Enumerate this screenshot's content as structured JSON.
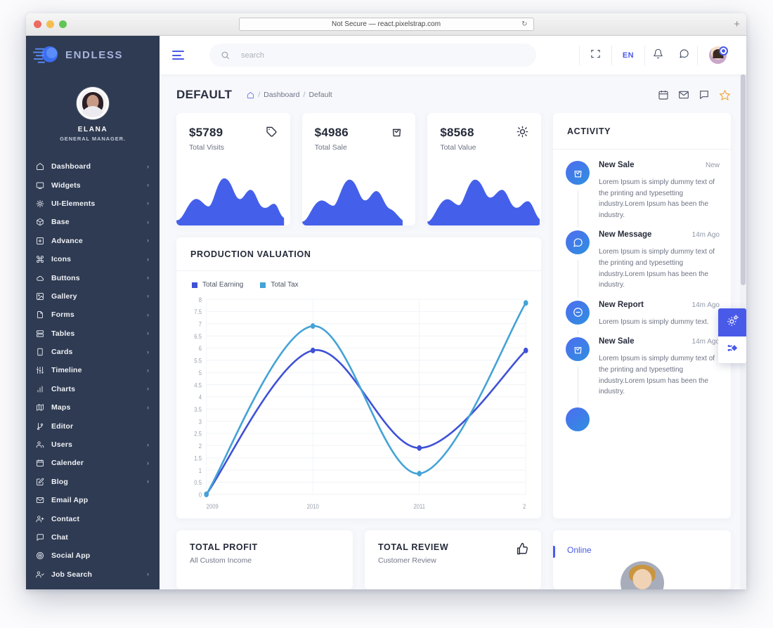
{
  "browser": {
    "url_text": "Not Secure — react.pixelstrap.com",
    "reload_icon": "reload-icon",
    "new_tab_label": "+"
  },
  "sidebar": {
    "brand": "ENDLESS",
    "profile": {
      "name": "ELANA",
      "role": "GENERAL MANAGER."
    },
    "items": [
      {
        "label": "Dashboard",
        "icon": "home-icon",
        "chevron": "›"
      },
      {
        "label": "Widgets",
        "icon": "monitor-icon",
        "chevron": "›"
      },
      {
        "label": "UI-Elements",
        "icon": "grid-dots-icon",
        "chevron": "›"
      },
      {
        "label": "Base",
        "icon": "box-icon",
        "chevron": "›"
      },
      {
        "label": "Advance",
        "icon": "plus-square-icon",
        "chevron": "›"
      },
      {
        "label": "Icons",
        "icon": "command-icon",
        "chevron": "›"
      },
      {
        "label": "Buttons",
        "icon": "cloud-icon",
        "chevron": "›"
      },
      {
        "label": "Gallery",
        "icon": "image-icon",
        "chevron": "›"
      },
      {
        "label": "Forms",
        "icon": "file-icon",
        "chevron": "›"
      },
      {
        "label": "Tables",
        "icon": "server-icon",
        "chevron": "›"
      },
      {
        "label": "Cards",
        "icon": "tablet-icon",
        "chevron": "›"
      },
      {
        "label": "Timeline",
        "icon": "sliders-icon",
        "chevron": "›"
      },
      {
        "label": "Charts",
        "icon": "bar-chart-icon",
        "chevron": "›"
      },
      {
        "label": "Maps",
        "icon": "map-icon",
        "chevron": "›"
      },
      {
        "label": "Editor",
        "icon": "git-branch-icon",
        "chevron": ""
      },
      {
        "label": "Users",
        "icon": "users-icon",
        "chevron": "›"
      },
      {
        "label": "Calender",
        "icon": "calendar-icon",
        "chevron": "›"
      },
      {
        "label": "Blog",
        "icon": "edit-square-icon",
        "chevron": "›"
      },
      {
        "label": "Email App",
        "icon": "mail-icon",
        "chevron": ""
      },
      {
        "label": "Contact",
        "icon": "user-plus-icon",
        "chevron": ""
      },
      {
        "label": "Chat",
        "icon": "message-square-icon",
        "chevron": ""
      },
      {
        "label": "Social App",
        "icon": "target-icon",
        "chevron": ""
      },
      {
        "label": "Job Search",
        "icon": "user-check-icon",
        "chevron": "›"
      }
    ]
  },
  "topbar": {
    "menu_icon": "hamburger-icon",
    "search": {
      "placeholder": "search",
      "value": "",
      "icon": "search-icon"
    },
    "fullscreen_icon": "fullscreen-icon",
    "language": "EN",
    "bell_icon": "bell-icon",
    "message_icon": "message-icon",
    "avatar": "user-avatar"
  },
  "page_head": {
    "title": "DEFAULT",
    "breadcrumb": {
      "home_icon": "home-icon",
      "items": [
        "Dashboard",
        "Default"
      ],
      "separator": "/"
    },
    "icons": [
      "calendar-icon",
      "mail-icon",
      "chat-icon",
      "star-icon"
    ]
  },
  "stats": [
    {
      "value": "$5789",
      "label": "Total Visits",
      "icon": "tag-icon"
    },
    {
      "value": "$4986",
      "label": "Total Sale",
      "icon": "shopping-bag-icon"
    },
    {
      "value": "$8568",
      "label": "Total Value",
      "icon": "sun-icon"
    }
  ],
  "chart_data": {
    "type": "line",
    "title": "PRODUCTION VALUATION",
    "x": [
      "2009",
      "2010",
      "2011",
      "2"
    ],
    "xlabel": "",
    "ylabel": "",
    "ylim": [
      0,
      8
    ],
    "yticks": [
      "8",
      "7.5",
      "7",
      "6.5",
      "6",
      "5.5",
      "5",
      "4.5",
      "4",
      "3.5",
      "3",
      "2.5",
      "2",
      "1.5",
      "1",
      "0.5",
      "0"
    ],
    "grid": true,
    "legend_position": "top-left",
    "series": [
      {
        "name": "Total Earning",
        "color": "#3f51d6",
        "values": [
          0,
          5.9,
          1.9,
          5.9
        ]
      },
      {
        "name": "Total Tax",
        "color": "#44a3d6",
        "values": [
          0,
          6.9,
          0.85,
          7.85
        ]
      }
    ]
  },
  "activity": {
    "title": "ACTIVITY",
    "items": [
      {
        "name": "New Sale",
        "time": "New",
        "icon": "shopping-bag-icon",
        "desc": "Lorem Ipsum is simply dummy text of the printing and typesetting industry.Lorem Ipsum has been the industry."
      },
      {
        "name": "New Message",
        "time": "14m Ago",
        "icon": "message-circle-icon",
        "desc": "Lorem Ipsum is simply dummy text of the printing and typesetting industry.Lorem Ipsum has been the industry."
      },
      {
        "name": "New Report",
        "time": "14m Ago",
        "icon": "minus-circle-icon",
        "desc": "Lorem Ipsum is simply dummy text."
      },
      {
        "name": "New Sale",
        "time": "14m Ago",
        "icon": "shopping-bag-icon",
        "desc": "Lorem Ipsum is simply dummy text of the printing and typesetting industry.Lorem Ipsum has been the industry."
      }
    ]
  },
  "bottom_cards": [
    {
      "title": "TOTAL PROFIT",
      "subtitle": "All Custom Income",
      "icon": ""
    },
    {
      "title": "TOTAL REVIEW",
      "subtitle": "Customer Review",
      "icon": "thumbs-up-icon"
    }
  ],
  "online_widget": {
    "label": "Online",
    "avatar": "person-avatar"
  },
  "float_buttons": [
    {
      "name": "settings-gear",
      "icon": "gear-icon",
      "active": true
    },
    {
      "name": "share",
      "icon": "share-icon",
      "active": false
    }
  ],
  "colors": {
    "accent": "#4a5ae8",
    "sidebar_bg": "#2f3b52",
    "page_bg": "#f7f8fc",
    "series_earning": "#3f51d6",
    "series_tax": "#44a3d6",
    "star": "#f0a93f"
  }
}
